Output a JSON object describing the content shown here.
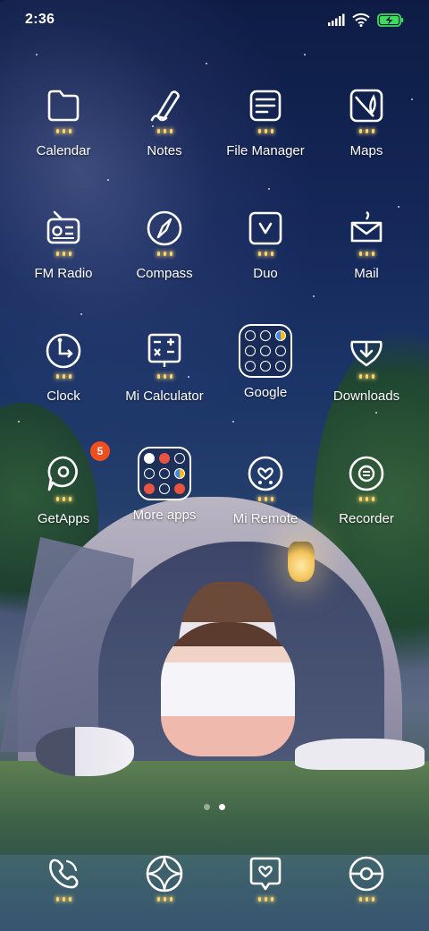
{
  "status_bar": {
    "time": "2:36",
    "icons": [
      "signal-icon",
      "wifi-icon",
      "battery-charging-icon"
    ],
    "battery_color": "#3ddc5c"
  },
  "apps": [
    {
      "label": "Calendar",
      "icon": "calendar-icon"
    },
    {
      "label": "Notes",
      "icon": "notes-icon"
    },
    {
      "label": "File Manager",
      "icon": "file-manager-icon"
    },
    {
      "label": "Maps",
      "icon": "maps-icon"
    },
    {
      "label": "FM Radio",
      "icon": "fm-radio-icon"
    },
    {
      "label": "Compass",
      "icon": "compass-icon"
    },
    {
      "label": "Duo",
      "icon": "duo-icon"
    },
    {
      "label": "Mail",
      "icon": "mail-icon"
    },
    {
      "label": "Clock",
      "icon": "clock-icon"
    },
    {
      "label": "Mi Calculator",
      "icon": "calculator-icon"
    },
    {
      "label": "Google",
      "icon": "google-folder-icon"
    },
    {
      "label": "Downloads",
      "icon": "downloads-icon"
    },
    {
      "label": "GetApps",
      "icon": "getapps-icon",
      "badge": "5"
    },
    {
      "label": "More apps",
      "icon": "more-apps-folder-icon"
    },
    {
      "label": "Mi Remote",
      "icon": "mi-remote-icon"
    },
    {
      "label": "Recorder",
      "icon": "recorder-icon"
    }
  ],
  "page_indicator": {
    "pages": 2,
    "current": 2
  },
  "dock": [
    {
      "icon": "phone-icon"
    },
    {
      "icon": "browser-icon"
    },
    {
      "icon": "messages-icon"
    },
    {
      "icon": "camera-icon"
    }
  ],
  "colors": {
    "badge": "#f04e1e",
    "light_bulbs": "#ffd66b"
  }
}
